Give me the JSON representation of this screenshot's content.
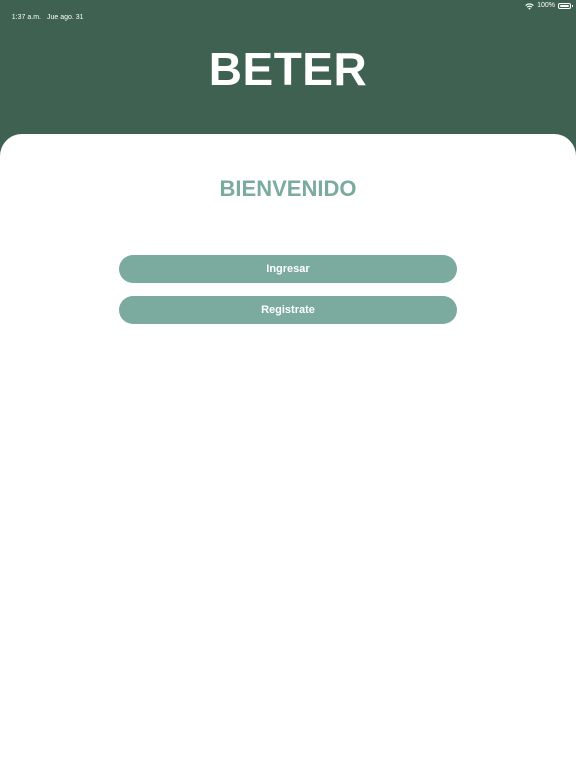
{
  "status_bar": {
    "time": "1:37 a.m.",
    "date": "Jue ago. 31",
    "battery": "100%",
    "icons": [
      "wifi-icon",
      "battery-icon"
    ]
  },
  "header": {
    "app_title": "BETER"
  },
  "main": {
    "welcome": "BIENVENIDO",
    "login_label": "Ingresar",
    "register_label": "Registrate"
  },
  "colors": {
    "header_bg": "#3f6151",
    "accent": "#7aab9e",
    "card_bg": "#ffffff"
  }
}
